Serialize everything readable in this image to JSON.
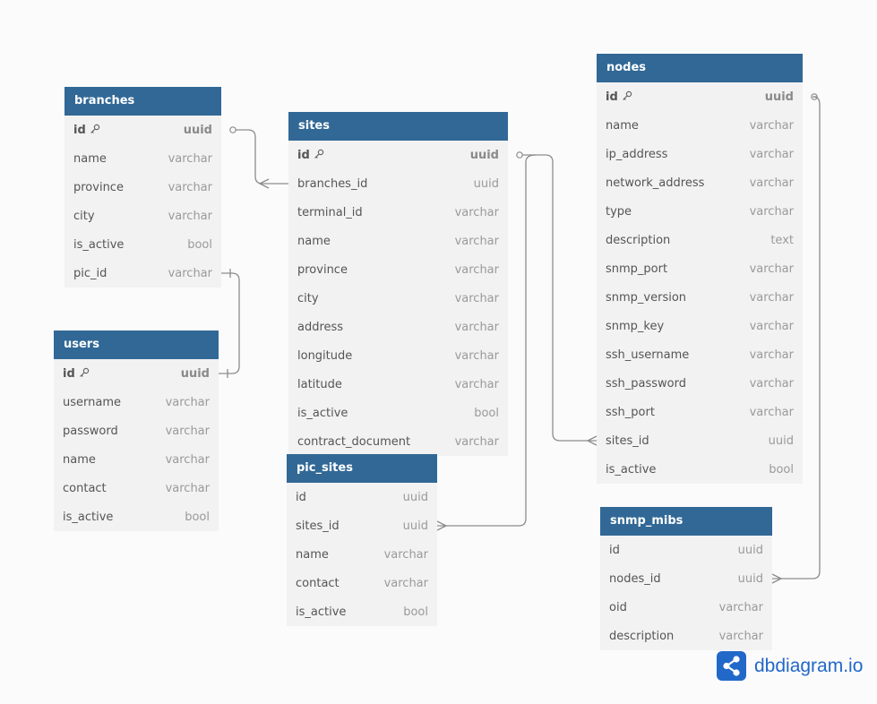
{
  "tables": [
    {
      "id": "branches",
      "name": "branches",
      "fields": [
        {
          "name": "id",
          "type": "uuid",
          "pk": true
        },
        {
          "name": "name",
          "type": "varchar"
        },
        {
          "name": "province",
          "type": "varchar"
        },
        {
          "name": "city",
          "type": "varchar"
        },
        {
          "name": "is_active",
          "type": "bool"
        },
        {
          "name": "pic_id",
          "type": "varchar"
        }
      ]
    },
    {
      "id": "users",
      "name": "users",
      "fields": [
        {
          "name": "id",
          "type": "uuid",
          "pk": true
        },
        {
          "name": "username",
          "type": "varchar"
        },
        {
          "name": "password",
          "type": "varchar"
        },
        {
          "name": "name",
          "type": "varchar"
        },
        {
          "name": "contact",
          "type": "varchar"
        },
        {
          "name": "is_active",
          "type": "bool"
        }
      ]
    },
    {
      "id": "sites",
      "name": "sites",
      "fields": [
        {
          "name": "id",
          "type": "uuid",
          "pk": true
        },
        {
          "name": "branches_id",
          "type": "uuid"
        },
        {
          "name": "terminal_id",
          "type": "varchar"
        },
        {
          "name": "name",
          "type": "varchar"
        },
        {
          "name": "province",
          "type": "varchar"
        },
        {
          "name": "city",
          "type": "varchar"
        },
        {
          "name": "address",
          "type": "varchar"
        },
        {
          "name": "longitude",
          "type": "varchar"
        },
        {
          "name": "latitude",
          "type": "varchar"
        },
        {
          "name": "is_active",
          "type": "bool"
        },
        {
          "name": "contract_document",
          "type": "varchar"
        }
      ]
    },
    {
      "id": "pic_sites",
      "name": "pic_sites",
      "fields": [
        {
          "name": "id",
          "type": "uuid"
        },
        {
          "name": "sites_id",
          "type": "uuid"
        },
        {
          "name": "name",
          "type": "varchar"
        },
        {
          "name": "contact",
          "type": "varchar"
        },
        {
          "name": "is_active",
          "type": "bool"
        }
      ]
    },
    {
      "id": "nodes",
      "name": "nodes",
      "fields": [
        {
          "name": "id",
          "type": "uuid",
          "pk": true
        },
        {
          "name": "name",
          "type": "varchar"
        },
        {
          "name": "ip_address",
          "type": "varchar"
        },
        {
          "name": "network_address",
          "type": "varchar"
        },
        {
          "name": "type",
          "type": "varchar"
        },
        {
          "name": "description",
          "type": "text"
        },
        {
          "name": "snmp_port",
          "type": "varchar"
        },
        {
          "name": "snmp_version",
          "type": "varchar"
        },
        {
          "name": "snmp_key",
          "type": "varchar"
        },
        {
          "name": "ssh_username",
          "type": "varchar"
        },
        {
          "name": "ssh_password",
          "type": "varchar"
        },
        {
          "name": "ssh_port",
          "type": "varchar"
        },
        {
          "name": "sites_id",
          "type": "uuid"
        },
        {
          "name": "is_active",
          "type": "bool"
        }
      ]
    },
    {
      "id": "snmp_mibs",
      "name": "snmp_mibs",
      "fields": [
        {
          "name": "id",
          "type": "uuid"
        },
        {
          "name": "nodes_id",
          "type": "uuid"
        },
        {
          "name": "oid",
          "type": "varchar"
        },
        {
          "name": "description",
          "type": "varchar"
        }
      ]
    }
  ],
  "relationships": [
    {
      "from": "branches.id",
      "to": "sites.branches_id",
      "type": "one-to-many"
    },
    {
      "from": "users.id",
      "to": "branches.pic_id",
      "type": "one-to-one"
    },
    {
      "from": "sites.id",
      "to": "nodes.sites_id",
      "type": "one-to-many"
    },
    {
      "from": "sites.id",
      "to": "pic_sites.sites_id",
      "type": "one-to-many"
    },
    {
      "from": "nodes.id",
      "to": "snmp_mibs.nodes_id",
      "type": "one-to-many"
    }
  ],
  "colors": {
    "header": "#316896",
    "body": "#f2f2f3",
    "line": "#8c8c8c",
    "brand": "#2268c8"
  },
  "icons": {
    "primary_key": "key-icon",
    "brand_logo": "share-icon"
  },
  "brand": {
    "label": "dbdiagram.io"
  }
}
